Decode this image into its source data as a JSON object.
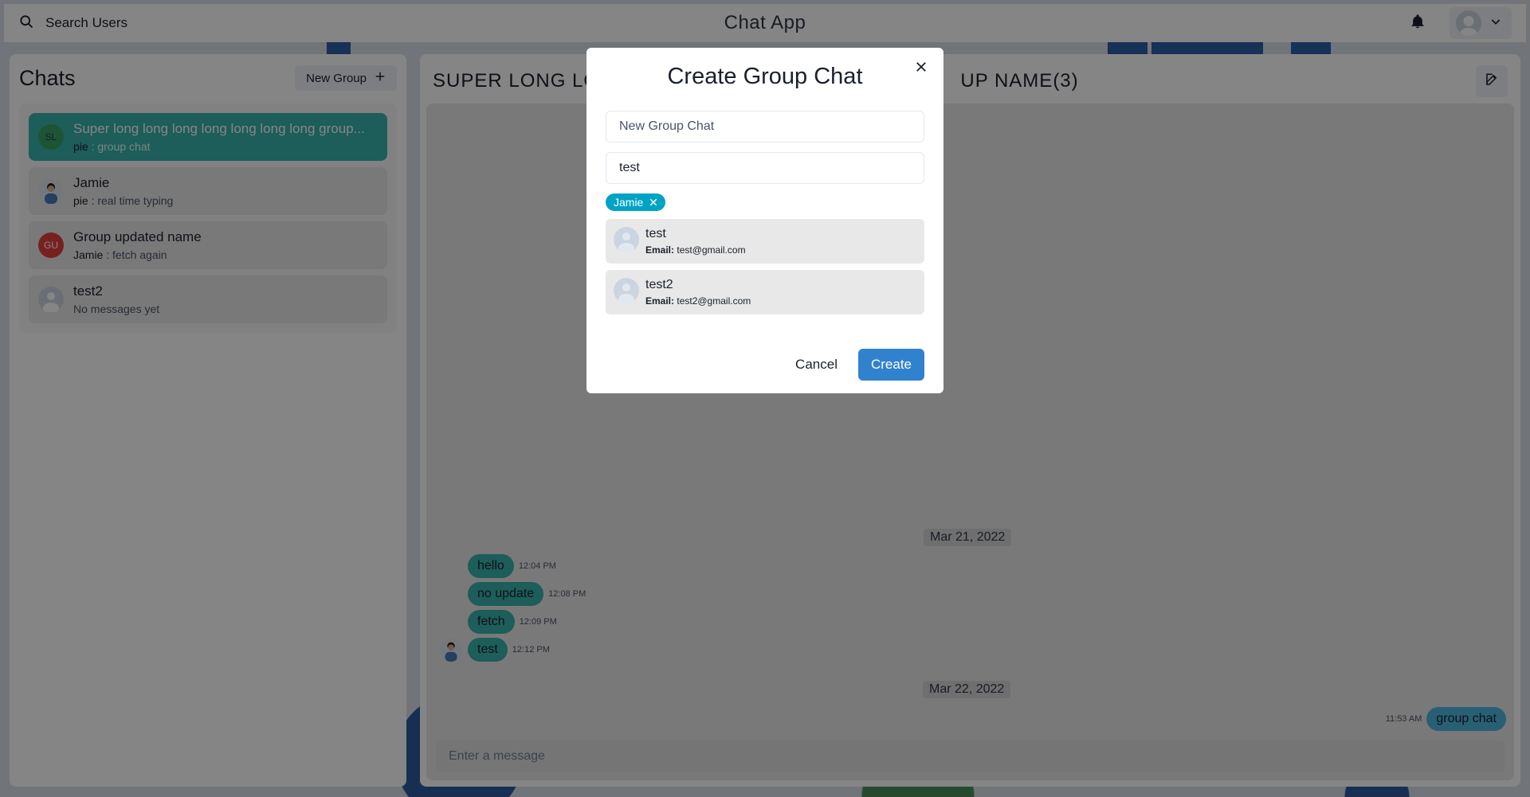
{
  "header": {
    "search_label": "Search Users",
    "app_title": "Chat App"
  },
  "chats": {
    "title": "Chats",
    "new_group_label": "New Group",
    "items": [
      {
        "initials": "SL",
        "name": "Super long long long long long long long group...",
        "sender": "pie",
        "preview": "group chat",
        "active": true,
        "avatar_color": "#38a169"
      },
      {
        "initials": "",
        "name": "Jamie",
        "sender": "pie",
        "preview": "real time typing",
        "active": false,
        "avatar_color": "#4a7ab8"
      },
      {
        "initials": "GU",
        "name": "Group updated name",
        "sender": "Jamie",
        "preview": "fetch again",
        "active": false,
        "avatar_color": "#e53e3e"
      },
      {
        "initials": "",
        "name": "test2",
        "sender": "",
        "preview": "No messages yet",
        "active": false,
        "avatar_color": "#cbd5e0"
      }
    ]
  },
  "conversation": {
    "title_left": "SUPER LONG LON",
    "title_right": "UP NAME",
    "member_count": "(3)",
    "dates": [
      "Mar 21, 2022",
      "Mar 22, 2022"
    ],
    "messages": [
      {
        "text": "hello",
        "time": "12:04 PM"
      },
      {
        "text": "no update",
        "time": "12:08 PM"
      },
      {
        "text": "fetch",
        "time": "12:09 PM"
      },
      {
        "text": "test",
        "time": "12:12 PM"
      },
      {
        "text": "group chat",
        "time": "11:53 AM"
      }
    ],
    "input_placeholder": "Enter a message"
  },
  "modal": {
    "title": "Create Group Chat",
    "name_placeholder": "New Group Chat",
    "search_value": "test",
    "selected_tag": "Jamie",
    "results": [
      {
        "name": "test",
        "email_label": "Email:",
        "email": "test@gmail.com"
      },
      {
        "name": "test2",
        "email_label": "Email:",
        "email": "test2@gmail.com"
      }
    ],
    "cancel_label": "Cancel",
    "create_label": "Create"
  },
  "colors": {
    "accent": "#38b2ac",
    "primary_button": "#3182ce",
    "tag": "#00a3c4"
  }
}
